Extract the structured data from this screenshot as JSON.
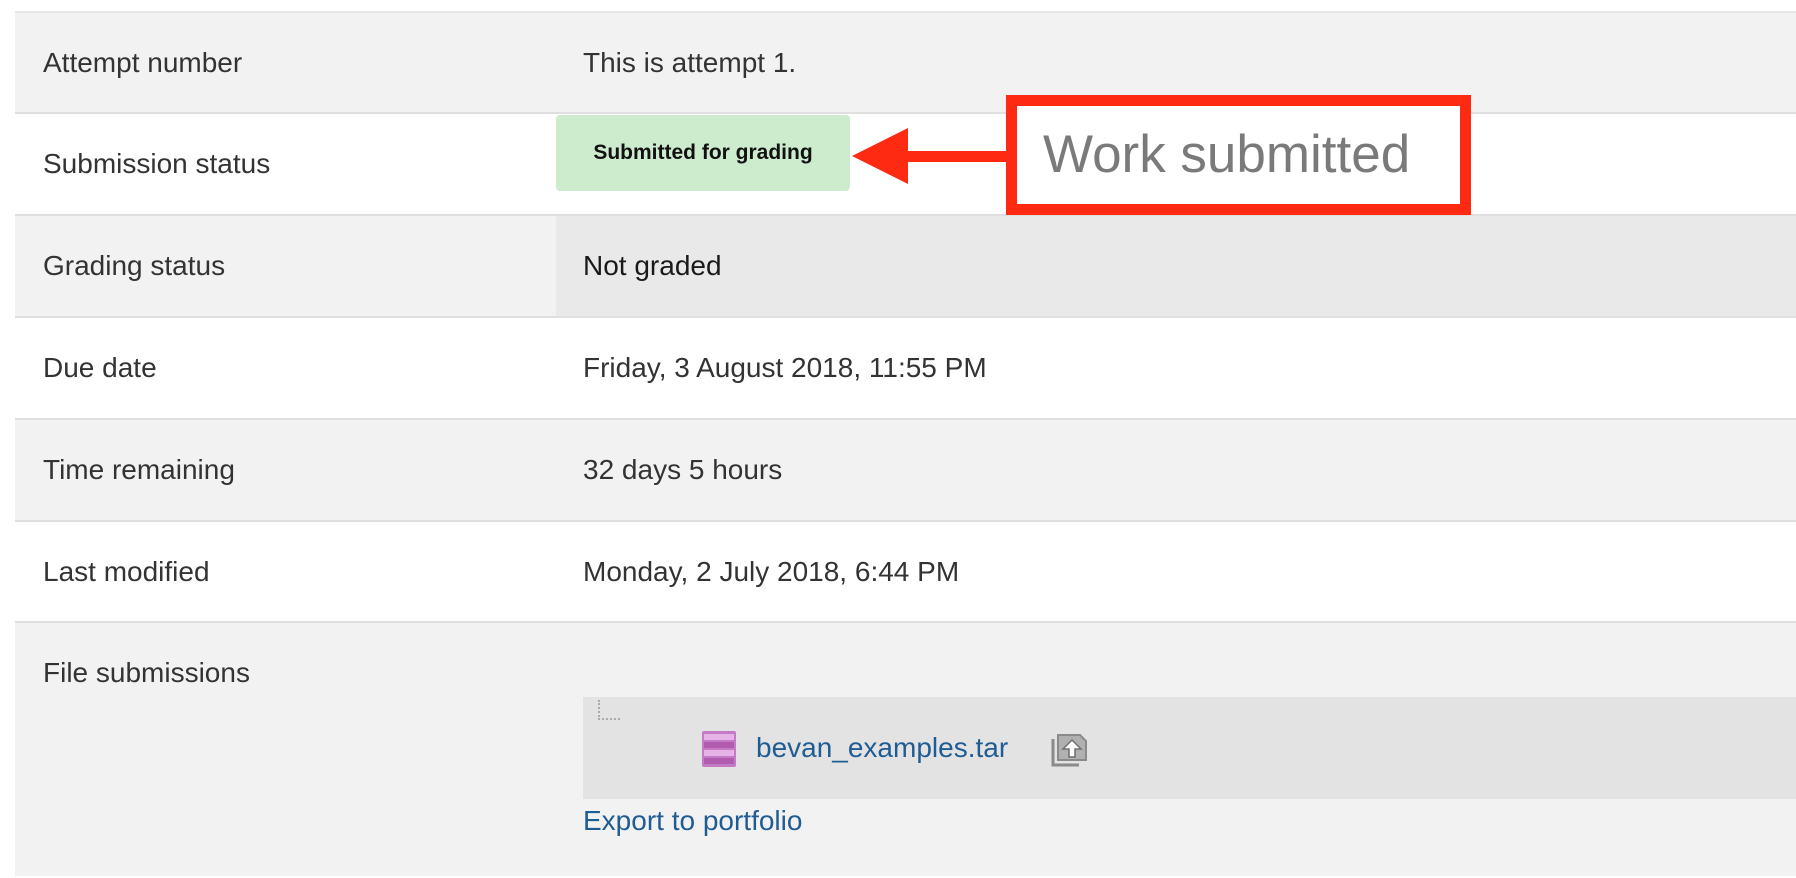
{
  "rows": {
    "attempt_number": {
      "label": "Attempt number",
      "value": "This is attempt 1."
    },
    "submission_status": {
      "label": "Submission status",
      "value": "Submitted for grading"
    },
    "grading_status": {
      "label": "Grading status",
      "value": "Not graded"
    },
    "due_date": {
      "label": "Due date",
      "value": "Friday, 3 August 2018, 11:55 PM"
    },
    "time_remaining": {
      "label": "Time remaining",
      "value": "32 days 5 hours"
    },
    "last_modified": {
      "label": "Last modified",
      "value": "Monday, 2 July 2018, 6:44 PM"
    },
    "file_submissions": {
      "label": "File submissions",
      "file_name": "bevan_examples.tar",
      "export_link": "Export to portfolio"
    }
  },
  "annotation": {
    "callout_text": "Work submitted",
    "color": "#ff2a12"
  },
  "colors": {
    "badge_bg": "#cdebcd",
    "link": "#1f5c94"
  },
  "icons": {
    "file_icon": "archive-file-icon",
    "export_icon": "portfolio-export-icon"
  }
}
